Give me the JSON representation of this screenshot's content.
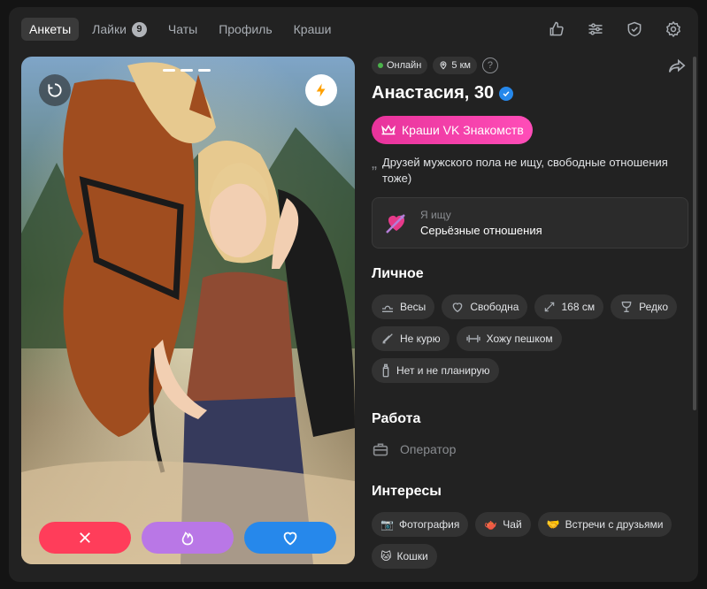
{
  "nav": {
    "tabs": [
      {
        "label": "Анкеты",
        "active": true
      },
      {
        "label": "Лайки",
        "badge": "9"
      },
      {
        "label": "Чаты"
      },
      {
        "label": "Профиль"
      },
      {
        "label": "Краши"
      }
    ],
    "icons": [
      "thumb-up-icon",
      "filters-icon",
      "shield-icon",
      "gear-icon"
    ]
  },
  "photo": {
    "icons": [
      "undo-icon",
      "lightning-icon"
    ],
    "actions": [
      "dislike-icon",
      "fire-icon",
      "heart-icon"
    ],
    "colors": {
      "dislike": "#ff3d5a",
      "fire": "#b977e6",
      "like": "#2688eb"
    }
  },
  "profile": {
    "status": "Онлайн",
    "distance": "5 км",
    "name": "Анастасия, 30",
    "crush_label": "Краши VK Знакомств",
    "bio": "Друзей мужского пола не ищу, свободные отношения тоже)",
    "seeking": {
      "label": "Я ищу",
      "value": "Серьёзные отношения"
    },
    "personal_title": "Личное",
    "personal_tags": [
      {
        "icon": "libra-icon",
        "label": "Весы"
      },
      {
        "icon": "heart-outline-icon",
        "label": "Свободна"
      },
      {
        "icon": "height-icon",
        "label": "168 см"
      },
      {
        "icon": "wine-glass-icon",
        "label": "Редко"
      },
      {
        "icon": "no-smoking-icon",
        "label": "Не курю"
      },
      {
        "icon": "dumbbell-icon",
        "label": "Хожу пешком"
      },
      {
        "icon": "baby-bottle-icon",
        "label": "Нет и не планирую"
      }
    ],
    "work_title": "Работа",
    "job": "Оператор",
    "interests_title": "Интересы",
    "interests": [
      {
        "icon": "camera-emoji",
        "label": "Фотография"
      },
      {
        "icon": "teapot-emoji",
        "label": "Чай"
      },
      {
        "icon": "handshake-emoji",
        "label": "Встречи с друзьями"
      },
      {
        "icon": "cat-emoji",
        "label": "Кошки"
      }
    ]
  }
}
